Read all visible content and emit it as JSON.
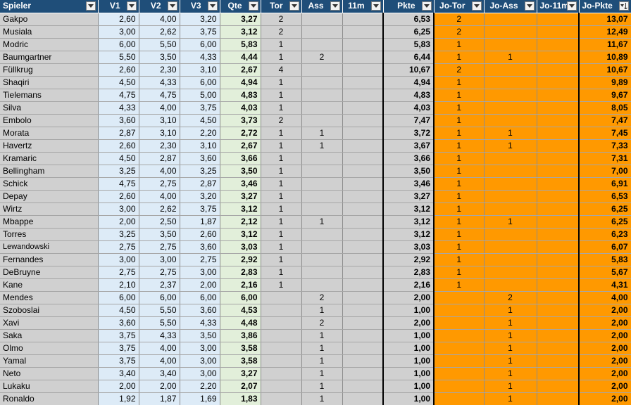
{
  "header": {
    "spieler": "Spieler",
    "v1": "V1",
    "v2": "V2",
    "v3": "V3",
    "qte": "Qte",
    "tor": "Tor",
    "ass": "Ass",
    "elf": "11m",
    "pkte": "Pkte",
    "jo_tor": "Jo-Tor",
    "jo_ass": "Jo-Ass",
    "jo_elf": "Jo-11m",
    "jo_pkte": "Jo-Pkte"
  },
  "icons": {
    "filter": "dropdown-arrow-icon",
    "sort": "sort-descending-icon"
  },
  "colors": {
    "header": "#1f4e79",
    "name_col": "#d0d0d0",
    "v_cols": "#ddebf7",
    "qte_col": "#e2efda",
    "jo_cols": "#ff9900"
  },
  "rows": [
    {
      "name": "Gakpo",
      "v1": "2,60",
      "v2": "4,00",
      "v3": "3,20",
      "qte": "3,27",
      "tor": "2",
      "ass": "",
      "elf": "",
      "pkte": "6,53",
      "jo_tor": "2",
      "jo_ass": "",
      "jo_elf": "",
      "jo_pkte": "13,07"
    },
    {
      "name": "Musiala",
      "v1": "3,00",
      "v2": "2,62",
      "v3": "3,75",
      "qte": "3,12",
      "tor": "2",
      "ass": "",
      "elf": "",
      "pkte": "6,25",
      "jo_tor": "2",
      "jo_ass": "",
      "jo_elf": "",
      "jo_pkte": "12,49"
    },
    {
      "name": "Modric",
      "v1": "6,00",
      "v2": "5,50",
      "v3": "6,00",
      "qte": "5,83",
      "tor": "1",
      "ass": "",
      "elf": "",
      "pkte": "5,83",
      "jo_tor": "1",
      "jo_ass": "",
      "jo_elf": "",
      "jo_pkte": "11,67"
    },
    {
      "name": "Baumgartner",
      "v1": "5,50",
      "v2": "3,50",
      "v3": "4,33",
      "qte": "4,44",
      "tor": "1",
      "ass": "2",
      "elf": "",
      "pkte": "6,44",
      "jo_tor": "1",
      "jo_ass": "1",
      "jo_elf": "",
      "jo_pkte": "10,89"
    },
    {
      "name": "Füllkrug",
      "v1": "2,60",
      "v2": "2,30",
      "v3": "3,10",
      "qte": "2,67",
      "tor": "4",
      "ass": "",
      "elf": "",
      "pkte": "10,67",
      "jo_tor": "2",
      "jo_ass": "",
      "jo_elf": "",
      "jo_pkte": "10,67"
    },
    {
      "name": "Shaqiri",
      "v1": "4,50",
      "v2": "4,33",
      "v3": "6,00",
      "qte": "4,94",
      "tor": "1",
      "ass": "",
      "elf": "",
      "pkte": "4,94",
      "jo_tor": "1",
      "jo_ass": "",
      "jo_elf": "",
      "jo_pkte": "9,89"
    },
    {
      "name": "Tielemans",
      "v1": "4,75",
      "v2": "4,75",
      "v3": "5,00",
      "qte": "4,83",
      "tor": "1",
      "ass": "",
      "elf": "",
      "pkte": "4,83",
      "jo_tor": "1",
      "jo_ass": "",
      "jo_elf": "",
      "jo_pkte": "9,67"
    },
    {
      "name": "Silva",
      "v1": "4,33",
      "v2": "4,00",
      "v3": "3,75",
      "qte": "4,03",
      "tor": "1",
      "ass": "",
      "elf": "",
      "pkte": "4,03",
      "jo_tor": "1",
      "jo_ass": "",
      "jo_elf": "",
      "jo_pkte": "8,05"
    },
    {
      "name": "Embolo",
      "v1": "3,60",
      "v2": "3,10",
      "v3": "4,50",
      "qte": "3,73",
      "tor": "2",
      "ass": "",
      "elf": "",
      "pkte": "7,47",
      "jo_tor": "1",
      "jo_ass": "",
      "jo_elf": "",
      "jo_pkte": "7,47"
    },
    {
      "name": "Morata",
      "v1": "2,87",
      "v2": "3,10",
      "v3": "2,20",
      "qte": "2,72",
      "tor": "1",
      "ass": "1",
      "elf": "",
      "pkte": "3,72",
      "jo_tor": "1",
      "jo_ass": "1",
      "jo_elf": "",
      "jo_pkte": "7,45"
    },
    {
      "name": "Havertz",
      "v1": "2,60",
      "v2": "2,30",
      "v3": "3,10",
      "qte": "2,67",
      "tor": "1",
      "ass": "1",
      "elf": "",
      "pkte": "3,67",
      "jo_tor": "1",
      "jo_ass": "1",
      "jo_elf": "",
      "jo_pkte": "7,33"
    },
    {
      "name": "Kramaric",
      "v1": "4,50",
      "v2": "2,87",
      "v3": "3,60",
      "qte": "3,66",
      "tor": "1",
      "ass": "",
      "elf": "",
      "pkte": "3,66",
      "jo_tor": "1",
      "jo_ass": "",
      "jo_elf": "",
      "jo_pkte": "7,31"
    },
    {
      "name": "Bellingham",
      "v1": "3,25",
      "v2": "4,00",
      "v3": "3,25",
      "qte": "3,50",
      "tor": "1",
      "ass": "",
      "elf": "",
      "pkte": "3,50",
      "jo_tor": "1",
      "jo_ass": "",
      "jo_elf": "",
      "jo_pkte": "7,00"
    },
    {
      "name": "Schick",
      "v1": "4,75",
      "v2": "2,75",
      "v3": "2,87",
      "qte": "3,46",
      "tor": "1",
      "ass": "",
      "elf": "",
      "pkte": "3,46",
      "jo_tor": "1",
      "jo_ass": "",
      "jo_elf": "",
      "jo_pkte": "6,91"
    },
    {
      "name": "Depay",
      "v1": "2,60",
      "v2": "4,00",
      "v3": "3,20",
      "qte": "3,27",
      "tor": "1",
      "ass": "",
      "elf": "",
      "pkte": "3,27",
      "jo_tor": "1",
      "jo_ass": "",
      "jo_elf": "",
      "jo_pkte": "6,53"
    },
    {
      "name": "Wirtz",
      "v1": "3,00",
      "v2": "2,62",
      "v3": "3,75",
      "qte": "3,12",
      "tor": "1",
      "ass": "",
      "elf": "",
      "pkte": "3,12",
      "jo_tor": "1",
      "jo_ass": "",
      "jo_elf": "",
      "jo_pkte": "6,25"
    },
    {
      "name": "Mbappe",
      "v1": "2,00",
      "v2": "2,50",
      "v3": "1,87",
      "qte": "2,12",
      "tor": "1",
      "ass": "1",
      "elf": "",
      "pkte": "3,12",
      "jo_tor": "1",
      "jo_ass": "1",
      "jo_elf": "",
      "jo_pkte": "6,25"
    },
    {
      "name": "Torres",
      "v1": "3,25",
      "v2": "3,50",
      "v3": "2,60",
      "qte": "3,12",
      "tor": "1",
      "ass": "",
      "elf": "",
      "pkte": "3,12",
      "jo_tor": "1",
      "jo_ass": "",
      "jo_elf": "",
      "jo_pkte": "6,23"
    },
    {
      "name": "Lewandowski",
      "v1": "2,75",
      "v2": "2,75",
      "v3": "3,60",
      "qte": "3,03",
      "tor": "1",
      "ass": "",
      "elf": "",
      "pkte": "3,03",
      "jo_tor": "1",
      "jo_ass": "",
      "jo_elf": "",
      "jo_pkte": "6,07",
      "small": true
    },
    {
      "name": "Fernandes",
      "v1": "3,00",
      "v2": "3,00",
      "v3": "2,75",
      "qte": "2,92",
      "tor": "1",
      "ass": "",
      "elf": "",
      "pkte": "2,92",
      "jo_tor": "1",
      "jo_ass": "",
      "jo_elf": "",
      "jo_pkte": "5,83"
    },
    {
      "name": "DeBruyne",
      "v1": "2,75",
      "v2": "2,75",
      "v3": "3,00",
      "qte": "2,83",
      "tor": "1",
      "ass": "",
      "elf": "",
      "pkte": "2,83",
      "jo_tor": "1",
      "jo_ass": "",
      "jo_elf": "",
      "jo_pkte": "5,67"
    },
    {
      "name": "Kane",
      "v1": "2,10",
      "v2": "2,37",
      "v3": "2,00",
      "qte": "2,16",
      "tor": "1",
      "ass": "",
      "elf": "",
      "pkte": "2,16",
      "jo_tor": "1",
      "jo_ass": "",
      "jo_elf": "",
      "jo_pkte": "4,31"
    },
    {
      "name": "Mendes",
      "v1": "6,00",
      "v2": "6,00",
      "v3": "6,00",
      "qte": "6,00",
      "tor": "",
      "ass": "2",
      "elf": "",
      "pkte": "2,00",
      "jo_tor": "",
      "jo_ass": "2",
      "jo_elf": "",
      "jo_pkte": "4,00"
    },
    {
      "name": "Szoboslai",
      "v1": "4,50",
      "v2": "5,50",
      "v3": "3,60",
      "qte": "4,53",
      "tor": "",
      "ass": "1",
      "elf": "",
      "pkte": "1,00",
      "jo_tor": "",
      "jo_ass": "1",
      "jo_elf": "",
      "jo_pkte": "2,00"
    },
    {
      "name": "Xavi",
      "v1": "3,60",
      "v2": "5,50",
      "v3": "4,33",
      "qte": "4,48",
      "tor": "",
      "ass": "2",
      "elf": "",
      "pkte": "2,00",
      "jo_tor": "",
      "jo_ass": "1",
      "jo_elf": "",
      "jo_pkte": "2,00"
    },
    {
      "name": "Saka",
      "v1": "3,75",
      "v2": "4,33",
      "v3": "3,50",
      "qte": "3,86",
      "tor": "",
      "ass": "1",
      "elf": "",
      "pkte": "1,00",
      "jo_tor": "",
      "jo_ass": "1",
      "jo_elf": "",
      "jo_pkte": "2,00"
    },
    {
      "name": "Olmo",
      "v1": "3,75",
      "v2": "4,00",
      "v3": "3,00",
      "qte": "3,58",
      "tor": "",
      "ass": "1",
      "elf": "",
      "pkte": "1,00",
      "jo_tor": "",
      "jo_ass": "1",
      "jo_elf": "",
      "jo_pkte": "2,00"
    },
    {
      "name": "Yamal",
      "v1": "3,75",
      "v2": "4,00",
      "v3": "3,00",
      "qte": "3,58",
      "tor": "",
      "ass": "1",
      "elf": "",
      "pkte": "1,00",
      "jo_tor": "",
      "jo_ass": "1",
      "jo_elf": "",
      "jo_pkte": "2,00"
    },
    {
      "name": "Neto",
      "v1": "3,40",
      "v2": "3,40",
      "v3": "3,00",
      "qte": "3,27",
      "tor": "",
      "ass": "1",
      "elf": "",
      "pkte": "1,00",
      "jo_tor": "",
      "jo_ass": "1",
      "jo_elf": "",
      "jo_pkte": "2,00"
    },
    {
      "name": "Lukaku",
      "v1": "2,00",
      "v2": "2,00",
      "v3": "2,20",
      "qte": "2,07",
      "tor": "",
      "ass": "1",
      "elf": "",
      "pkte": "1,00",
      "jo_tor": "",
      "jo_ass": "1",
      "jo_elf": "",
      "jo_pkte": "2,00"
    },
    {
      "name": "Ronaldo",
      "v1": "1,92",
      "v2": "1,87",
      "v3": "1,69",
      "qte": "1,83",
      "tor": "",
      "ass": "1",
      "elf": "",
      "pkte": "1,00",
      "jo_tor": "",
      "jo_ass": "1",
      "jo_elf": "",
      "jo_pkte": "2,00"
    }
  ]
}
